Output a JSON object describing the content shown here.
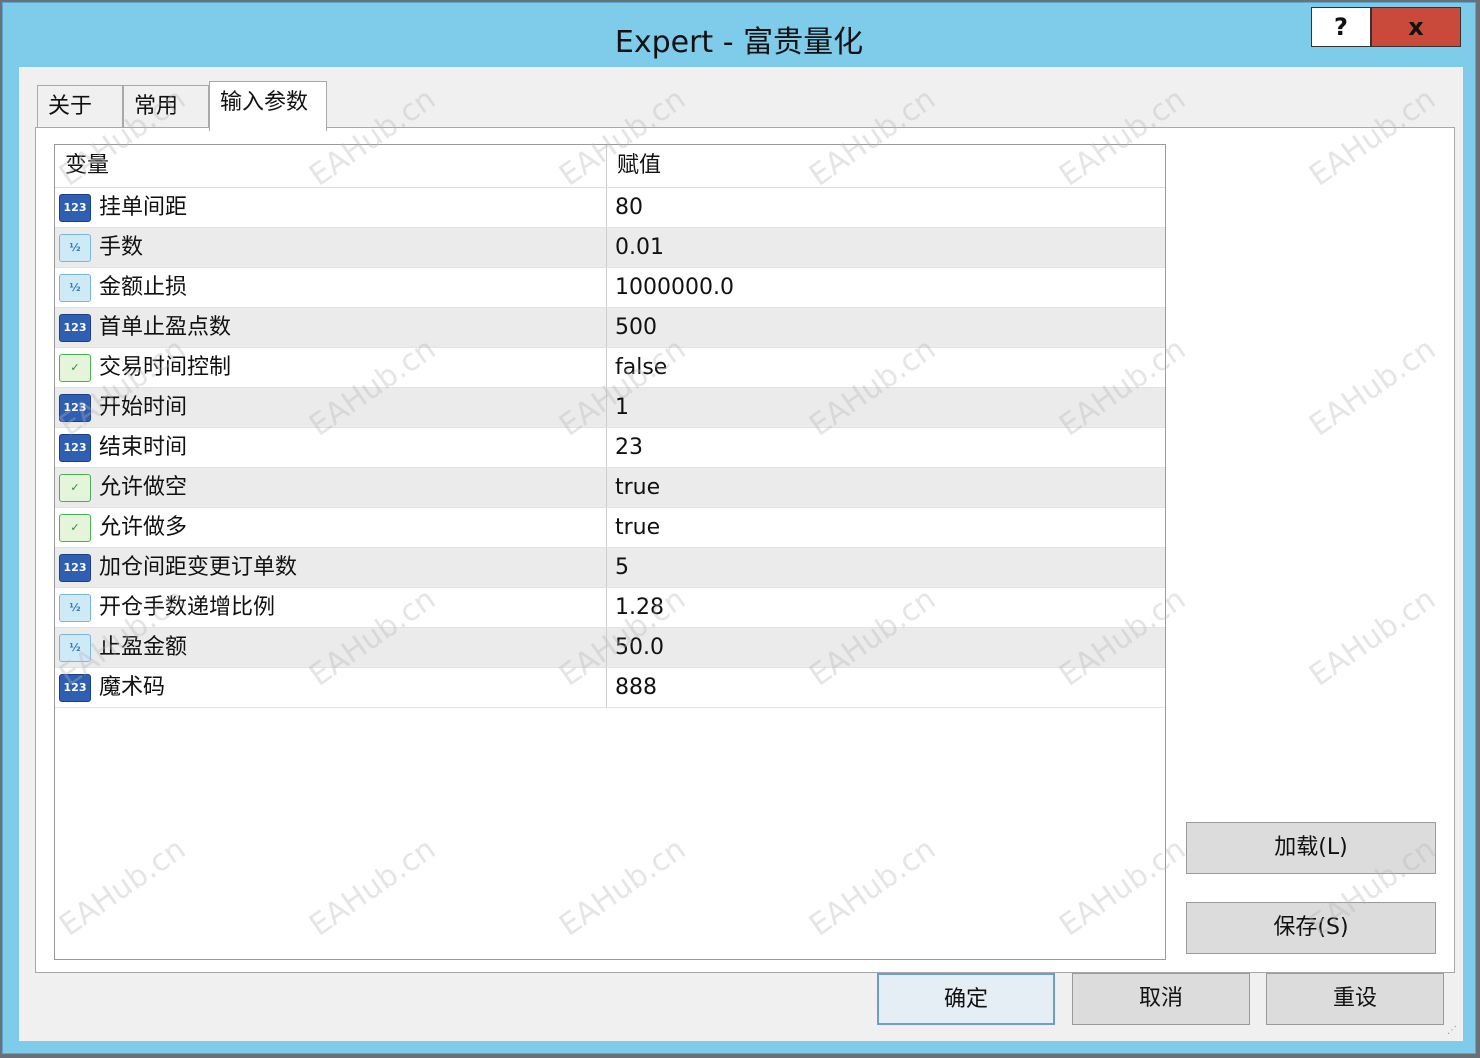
{
  "window": {
    "title": "Expert - 富贵量化",
    "help_label": "?",
    "close_label": "x"
  },
  "tabs": [
    {
      "label": "关于",
      "active": false
    },
    {
      "label": "常用",
      "active": false
    },
    {
      "label": "输入参数",
      "active": true
    }
  ],
  "table": {
    "headers": [
      "变量",
      "赋值"
    ],
    "rows": [
      {
        "type_icon": "int-icon",
        "name": "挂单间距",
        "value": "80"
      },
      {
        "type_icon": "double-icon",
        "name": "手数",
        "value": "0.01"
      },
      {
        "type_icon": "double-icon",
        "name": "金额止损",
        "value": "1000000.0"
      },
      {
        "type_icon": "int-icon",
        "name": "首单止盈点数",
        "value": "500"
      },
      {
        "type_icon": "bool-icon",
        "name": "交易时间控制",
        "value": "false"
      },
      {
        "type_icon": "int-icon",
        "name": "开始时间",
        "value": "1"
      },
      {
        "type_icon": "int-icon",
        "name": "结束时间",
        "value": "23"
      },
      {
        "type_icon": "bool-icon",
        "name": "允许做空",
        "value": "true"
      },
      {
        "type_icon": "bool-icon",
        "name": "允许做多",
        "value": "true"
      },
      {
        "type_icon": "int-icon",
        "name": "加仓间距变更订单数",
        "value": "5"
      },
      {
        "type_icon": "double-icon",
        "name": "开仓手数递增比例",
        "value": "1.28"
      },
      {
        "type_icon": "double-icon",
        "name": "止盈金额",
        "value": "50.0"
      },
      {
        "type_icon": "int-icon",
        "name": "魔术码",
        "value": "888"
      }
    ]
  },
  "side_buttons": {
    "load_label": "加载(L)",
    "save_label": "保存(S)"
  },
  "bottom_buttons": {
    "ok_label": "确定",
    "cancel_label": "取消",
    "reset_label": "重设"
  },
  "watermark": "EAHub.cn",
  "colors": {
    "titlebar": "#7ecbea",
    "close_button": "#c9493a"
  }
}
